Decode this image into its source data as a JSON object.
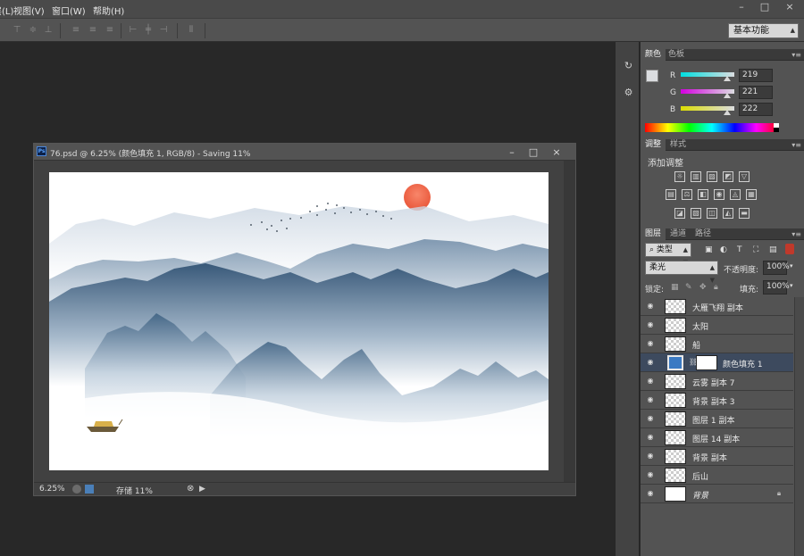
{
  "menu": {
    "items": [
      "图层(L)",
      "视图(V)",
      "窗口(W)",
      "帮助(H)"
    ]
  },
  "window_controls": {
    "minimize": "–",
    "restore": "□",
    "close": "×"
  },
  "toolbar": {
    "workspace": "基本功能"
  },
  "document": {
    "title": "76.psd @ 6.25% (颜色填充 1, RGB/8) - Saving 11%",
    "zoom": "6.25%",
    "status": "存储 11%",
    "controls": {
      "minimize": "–",
      "maximize": "□",
      "close": "×"
    }
  },
  "color_panel": {
    "tabs": [
      "颜色",
      "色板"
    ],
    "active_tab": "颜色",
    "channels": [
      {
        "label": "R",
        "value": "219",
        "fraction": 0.859
      },
      {
        "label": "G",
        "value": "221",
        "fraction": 0.867
      },
      {
        "label": "B",
        "value": "222",
        "fraction": 0.871
      }
    ],
    "foreground_color": "#dbdde0",
    "background_color": "#000000"
  },
  "adjustments_panel": {
    "tabs": [
      "调整",
      "样式"
    ],
    "active_tab": "调整",
    "heading": "添加调整",
    "icons": [
      "brightness-icon",
      "levels-icon",
      "curves-icon",
      "exposure-icon",
      "vibrance-icon",
      "hue-saturation-icon",
      "color-balance-icon",
      "black-white-icon",
      "photo-filter-icon",
      "channel-mixer-icon",
      "color-lookup-icon",
      "invert-icon",
      "posterize-icon",
      "threshold-icon",
      "selective-color-icon",
      "gradient-map-icon"
    ]
  },
  "layers_panel": {
    "tabs": [
      "图层",
      "通道",
      "路径"
    ],
    "active_tab": "图层",
    "filter_type": "类型",
    "blend_mode": "柔光",
    "opacity_label": "不透明度:",
    "opacity": "100%",
    "lock_label": "锁定:",
    "fill_label": "填充:",
    "fill": "100%",
    "layers": [
      {
        "name": "大雁飞翔 副本",
        "kind": "transparent"
      },
      {
        "name": "太阳",
        "kind": "transparent"
      },
      {
        "name": "船",
        "kind": "transparent"
      },
      {
        "name": "颜色填充 1",
        "kind": "fill",
        "selected": true,
        "fill_color": "#3b7ac3"
      },
      {
        "name": "云雾 副本 7",
        "kind": "transparent"
      },
      {
        "name": "背景 副本 3",
        "kind": "transparent"
      },
      {
        "name": "图层 1 副本",
        "kind": "transparent"
      },
      {
        "name": "图层 14 副本",
        "kind": "transparent"
      },
      {
        "name": "背景 副本",
        "kind": "transparent"
      },
      {
        "name": "后山",
        "kind": "transparent"
      },
      {
        "name": "背景",
        "kind": "background",
        "locked": true
      }
    ]
  },
  "colors": {
    "accent": "#3b7ac3",
    "sun": "#ee6c4e",
    "mountain": "#2c4e70"
  }
}
